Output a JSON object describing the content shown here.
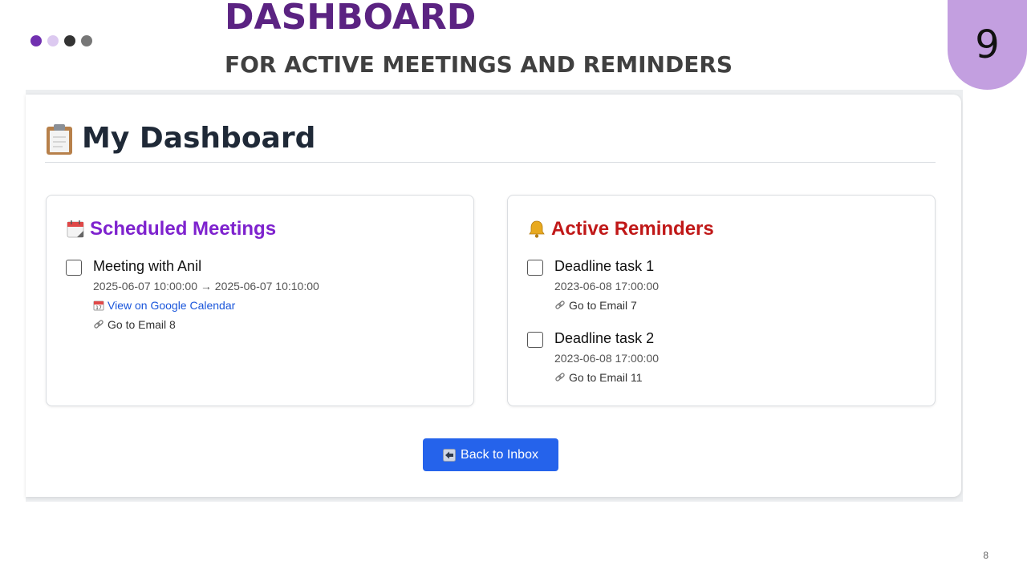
{
  "slide": {
    "title": "DASHBOARD",
    "subtitle": "FOR ACTIVE MEETINGS AND REMINDERS",
    "badge_number": "9",
    "page_number": "8",
    "dots": [
      "#7130b0",
      "#dcc9f0",
      "#333333",
      "#777777"
    ]
  },
  "dashboard": {
    "title": "My Dashboard",
    "title_icon": "clipboard-icon"
  },
  "meetings": {
    "heading": "Scheduled Meetings",
    "heading_icon": "calendar-icon",
    "items": [
      {
        "title": "Meeting with Anil",
        "time": "2025-06-07 10:00:00 → 2025-06-07 10:10:00",
        "calendar_link": "View on Google Calendar",
        "email_link": "Go to Email 8",
        "checked": false
      }
    ]
  },
  "reminders": {
    "heading": "Active Reminders",
    "heading_icon": "bell-icon",
    "items": [
      {
        "title": "Deadline task 1",
        "time": "2023-06-08 17:00:00",
        "email_link": "Go to Email 7",
        "checked": false
      },
      {
        "title": "Deadline task 2",
        "time": "2023-06-08 17:00:00",
        "email_link": "Go to Email 11",
        "checked": false
      }
    ]
  },
  "back_button": {
    "label": "Back to Inbox",
    "icon": "back-arrow-icon"
  },
  "colors": {
    "title_purple": "#5b2382",
    "meetings_purple": "#7e22ce",
    "reminders_red": "#c01818",
    "button_blue": "#2563eb",
    "badge_lilac": "#c39fe0"
  }
}
